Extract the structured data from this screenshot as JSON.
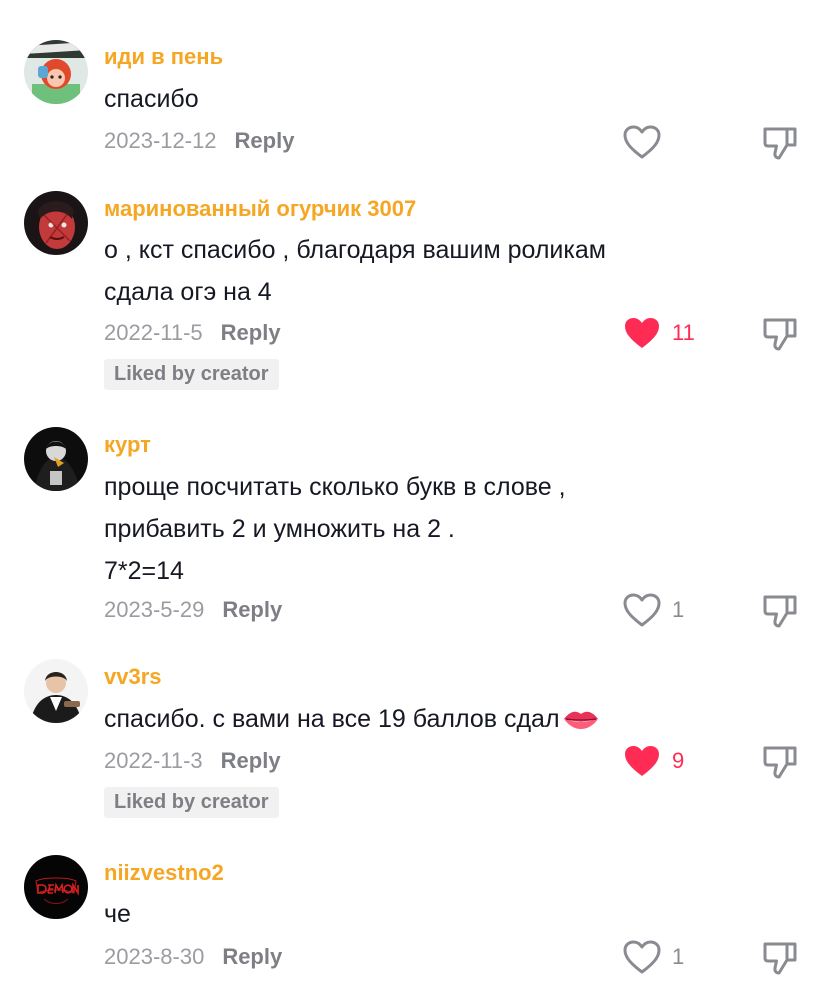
{
  "colors": {
    "username": "#f5a623",
    "text": "#161823",
    "meta": "#9b9ca2",
    "liked": "#fe2c55",
    "badge_bg": "#f1f1f2"
  },
  "comments": [
    {
      "username": "иди в  пень",
      "lines": [
        "спасибо"
      ],
      "date": "2023-12-12",
      "reply": "Reply",
      "liked": false,
      "like_count": "",
      "badge": ""
    },
    {
      "username": "маринованный огурчик 3007",
      "lines": [
        "о , кст спасибо , благодаря вашим роликам",
        "сдала огэ на 4"
      ],
      "date": "2022-11-5",
      "reply": "Reply",
      "liked": true,
      "like_count": "11",
      "badge": "Liked by creator"
    },
    {
      "username": "курт",
      "lines": [
        "проще посчитать сколько букв в слове ,",
        "прибавить 2 и умножить на 2 .",
        "7*2=14"
      ],
      "date": "2023-5-29",
      "reply": "Reply",
      "liked": false,
      "like_count": "1",
      "badge": ""
    },
    {
      "username": "vv3rs",
      "lines": [
        "спасибо. с вами на все 19 баллов сдал"
      ],
      "emoji": "lips-emoji",
      "date": "2022-11-3",
      "reply": "Reply",
      "liked": true,
      "like_count": "9",
      "badge": "Liked by creator"
    },
    {
      "username": "niizvestno2",
      "lines": [
        "че"
      ],
      "date": "2023-8-30",
      "reply": "Reply",
      "liked": false,
      "like_count": "1",
      "badge": ""
    }
  ],
  "icons": {
    "like_outline": "heart-outline-icon",
    "like_filled": "heart-filled-icon",
    "dislike": "thumbs-down-icon"
  }
}
